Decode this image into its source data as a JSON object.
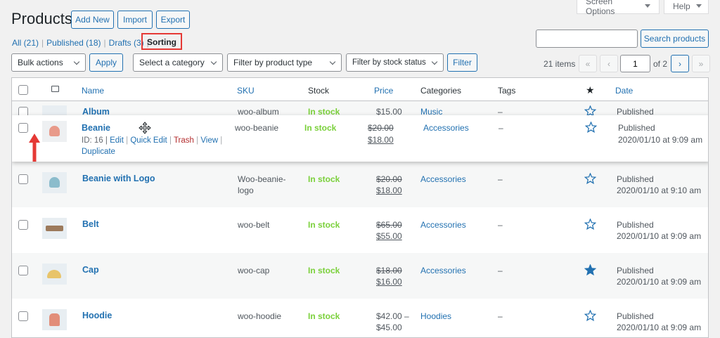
{
  "header": {
    "title": "Products",
    "add_new": "Add New",
    "import": "Import",
    "export": "Export",
    "screen_options": "Screen Options",
    "help": "Help"
  },
  "filters": {
    "all": "All (21)",
    "published": "Published (18)",
    "drafts": "Drafts (3)",
    "sorting": "Sorting",
    "sep": "|"
  },
  "search": {
    "value": "",
    "button": "Search products"
  },
  "toolbar": {
    "bulk_actions": "Bulk actions",
    "apply": "Apply",
    "category": "Select a category",
    "product_type": "Filter by product type",
    "stock_status": "Filter by stock status",
    "filter": "Filter"
  },
  "pagination": {
    "items": "21 items",
    "first": "«",
    "prev": "‹",
    "current_page": "1",
    "of": "of 2",
    "next": "›",
    "last": "»"
  },
  "columns": {
    "name": "Name",
    "sku": "SKU",
    "stock": "Stock",
    "price": "Price",
    "categories": "Categories",
    "tags": "Tags",
    "date": "Date"
  },
  "rows": [
    {
      "name": "Album",
      "sku": "woo-album",
      "stock": "In stock",
      "price": "$15.00",
      "category": "Music",
      "tags": "–",
      "status": "Published",
      "featured": false
    },
    {
      "name": "Beanie",
      "meta": "ID: 16 |",
      "edit": "Edit",
      "quick_edit": "Quick Edit",
      "trash": "Trash",
      "view": "View",
      "duplicate": "Duplicate",
      "sku": "woo-beanie",
      "stock": "In stock",
      "old_price": "$20.00",
      "price": "$18.00",
      "category": "Accessories",
      "tags": "–",
      "status": "Published",
      "date": "2020/01/10 at 9:09 am",
      "featured": false
    },
    {
      "name": "Beanie with Logo",
      "sku1": "Woo-beanie-",
      "sku2": "logo",
      "stock": "In stock",
      "old_price": "$20.00",
      "price": "$18.00",
      "category": "Accessories",
      "tags": "–",
      "status": "Published",
      "date": "2020/01/10 at 9:10 am",
      "featured": false
    },
    {
      "name": "Belt",
      "sku": "woo-belt",
      "stock": "In stock",
      "old_price": "$65.00",
      "price": "$55.00",
      "category": "Accessories",
      "tags": "–",
      "status": "Published",
      "date": "2020/01/10 at 9:09 am",
      "featured": false
    },
    {
      "name": "Cap",
      "sku": "woo-cap",
      "stock": "In stock",
      "old_price": "$18.00",
      "price": "$16.00",
      "category": "Accessories",
      "tags": "–",
      "status": "Published",
      "date": "2020/01/10 at 9:09 am",
      "featured": true
    },
    {
      "name": "Hoodie",
      "sku": "woo-hoodie",
      "stock": "In stock",
      "price_range1": "$42.00 –",
      "price_range2": "$45.00",
      "category": "Hoodies",
      "tags": "–",
      "status": "Published",
      "date": "2020/01/10 at 9:09 am",
      "featured": false
    }
  ],
  "colors": {
    "link": "#2271b1",
    "in_stock": "#7ad03a",
    "trash": "#b32d2e",
    "annotation": "#e53935",
    "star": "#2271b1"
  }
}
